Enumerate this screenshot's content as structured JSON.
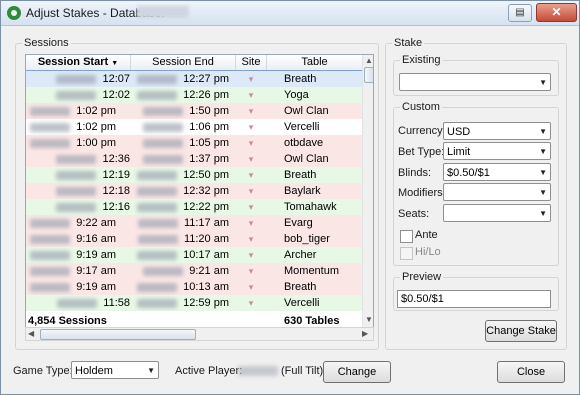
{
  "window": {
    "title": "Adjust Stakes - Database:"
  },
  "sessions": {
    "legend": "Sessions",
    "columns": [
      "Session Start",
      "Session End",
      "Site",
      "Table"
    ],
    "rows": [
      {
        "start": "12:07 pm",
        "end": "12:27 pm",
        "table": "Breath",
        "status": "selected"
      },
      {
        "start": "12:02 pm",
        "end": "12:26 pm",
        "table": "Yoga",
        "status": "win"
      },
      {
        "start": "1:02 pm",
        "end": "1:50 pm",
        "table": "Owl Clan",
        "status": "loss"
      },
      {
        "start": "1:02 pm",
        "end": "1:06 pm",
        "table": "Vercelli",
        "status": "neutral"
      },
      {
        "start": "1:00 pm",
        "end": "1:05 pm",
        "table": "otbdave",
        "status": "loss"
      },
      {
        "start": "12:36 pm",
        "end": "1:37 pm",
        "table": "Owl Clan",
        "status": "loss"
      },
      {
        "start": "12:19 pm",
        "end": "12:50 pm",
        "table": "Breath",
        "status": "win"
      },
      {
        "start": "12:18 pm",
        "end": "12:32 pm",
        "table": "Baylark",
        "status": "loss"
      },
      {
        "start": "12:16 pm",
        "end": "12:22 pm",
        "table": "Tomahawk",
        "status": "win"
      },
      {
        "start": "9:22 am",
        "end": "11:17 am",
        "table": "Evarg",
        "status": "loss"
      },
      {
        "start": "9:16 am",
        "end": "11:20 am",
        "table": "bob_tiger",
        "status": "loss"
      },
      {
        "start": "9:19 am",
        "end": "10:17 am",
        "table": "Archer",
        "status": "win"
      },
      {
        "start": "9:17 am",
        "end": "9:21 am",
        "table": "Momentum",
        "status": "loss"
      },
      {
        "start": "9:19 am",
        "end": "10:13 am",
        "table": "Breath",
        "status": "loss"
      },
      {
        "start": "11:58 am",
        "end": "12:59 pm",
        "table": "Vercelli",
        "status": "win"
      }
    ],
    "footer": {
      "sessions": "4,854 Sessions",
      "tables": "630 Tables"
    }
  },
  "stake": {
    "legend": "Stake",
    "existing_legend": "Existing",
    "existing_value": "",
    "custom_legend": "Custom",
    "currency_label": "Currency:",
    "currency_value": "USD",
    "bettype_label": "Bet Type:",
    "bettype_value": "Limit",
    "blinds_label": "Blinds:",
    "blinds_value": "$0.50/$1",
    "modifiers_label": "Modifiers:",
    "modifiers_value": "",
    "seats_label": "Seats:",
    "seats_value": "",
    "ante_label": "Ante",
    "hilo_label": "Hi/Lo",
    "preview_legend": "Preview",
    "preview_value": "$0.50/$1",
    "change_stake_label": "Change Stake"
  },
  "bottom": {
    "game_type_label": "Game Type:",
    "game_type_value": "Holdem",
    "active_player_label": "Active Player:",
    "active_player_site": "(Full Tilt)",
    "change_label": "Change",
    "close_label": "Close"
  },
  "colors": {
    "win": "#e7f8e7",
    "loss": "#fbe6e6",
    "neutral": "#ffffff",
    "selected": "#dde9f8"
  }
}
